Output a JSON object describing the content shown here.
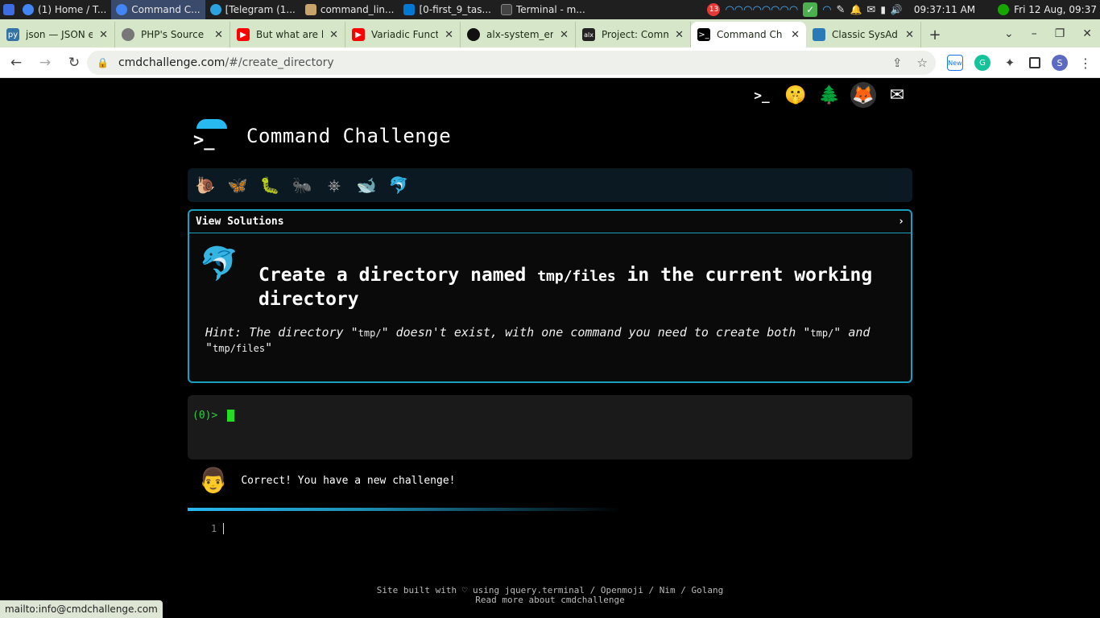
{
  "taskbar": {
    "tasks": [
      {
        "label": "(1) Home / T...",
        "active": false,
        "color": "#4285f4"
      },
      {
        "label": "Command C...",
        "active": true,
        "color": "#4285f4"
      },
      {
        "label": "[Telegram (1...",
        "active": false,
        "color": "#2aa3df"
      },
      {
        "label": "command_lin...",
        "active": false,
        "color": "#c8a46a"
      },
      {
        "label": "[0-first_9_tas...",
        "active": false,
        "color": "#0078d4"
      },
      {
        "label": "Terminal - m...",
        "active": false,
        "color": "#333333"
      }
    ],
    "notification_count": "13",
    "clock": "09:37:11 AM",
    "date": "Fri 12 Aug, 09:37"
  },
  "browser": {
    "tabs": [
      {
        "label": "json — JSON e",
        "icon_color": "#3572A5",
        "active": false
      },
      {
        "label": "PHP's Source",
        "icon_color": "#777777",
        "active": false
      },
      {
        "label": "But what are l",
        "icon_color": "#ff0000",
        "active": false
      },
      {
        "label": "Variadic Funct",
        "icon_color": "#ff0000",
        "active": false
      },
      {
        "label": "alx-system_er",
        "icon_color": "#111111",
        "active": false
      },
      {
        "label": "Project: Comm",
        "icon_color": "#222222",
        "active": false
      },
      {
        "label": "Command Ch",
        "icon_color": "#000000",
        "active": true
      },
      {
        "label": "Classic SysAdi",
        "icon_color": "#2a7ab8",
        "active": false
      }
    ],
    "url_host": "cmdchallenge.com",
    "url_path": "/#/create_directory",
    "extension_new_badge": "New",
    "profile_initial": "S"
  },
  "page": {
    "site_title": "Command Challenge",
    "prompt_glyph": ">_",
    "view_solutions": "View Solutions",
    "chevron": "›",
    "challenge": {
      "title_part1": "Create a directory named ",
      "title_code": "tmp/files",
      "title_part2": " in the current working directory",
      "hint_part1": "Hint: The directory \"",
      "hint_code1": "tmp/",
      "hint_part2": "\" doesn't exist, with one command you need to create both \"",
      "hint_code2": "tmp/",
      "hint_part3": "\" and \"",
      "hint_code3": "tmp/files",
      "hint_part4": "\""
    },
    "terminal_prompt": "(0)> ",
    "feedback": "Correct! You have a new challenge!",
    "editor_line_number": "1",
    "footer_line1": "Site built with ♡ using jquery.terminal / Openmoji / Nim / Golang",
    "footer_line2": "Read more about cmdchallenge"
  },
  "status_url": "mailto:info@cmdchallenge.com",
  "colors": {
    "accent": "#27b9f0",
    "border": "#1a9fbf",
    "prompt_green": "#2ecc40"
  }
}
